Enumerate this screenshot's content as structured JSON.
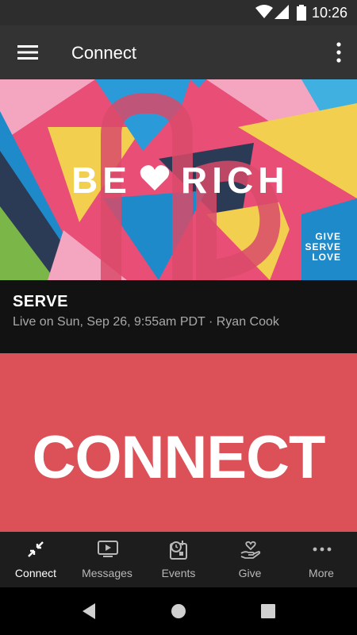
{
  "status_bar": {
    "time": "10:26"
  },
  "app_bar": {
    "title": "Connect"
  },
  "banner": {
    "headline_left": "BE",
    "headline_right": "RICH",
    "tagline": [
      "GIVE",
      "SERVE",
      "LOVE"
    ]
  },
  "serve_card": {
    "title": "SERVE",
    "subtitle": "Live on Sun, Sep 26, 9:55am PDT · Ryan Cook"
  },
  "connect_card": {
    "text": "CONNECT"
  },
  "bottom_nav": {
    "items": [
      {
        "label": "Connect",
        "icon": "connect-icon",
        "active": true
      },
      {
        "label": "Messages",
        "icon": "tv-play-icon",
        "active": false
      },
      {
        "label": "Events",
        "icon": "calendar-clock-icon",
        "active": false
      },
      {
        "label": "Give",
        "icon": "heart-hand-icon",
        "active": false
      },
      {
        "label": "More",
        "icon": "more-horizontal-icon",
        "active": false
      }
    ]
  },
  "colors": {
    "app_bar": "#333333",
    "connect_card": "#dc5158",
    "bottom_nav": "#1d1d1d"
  }
}
